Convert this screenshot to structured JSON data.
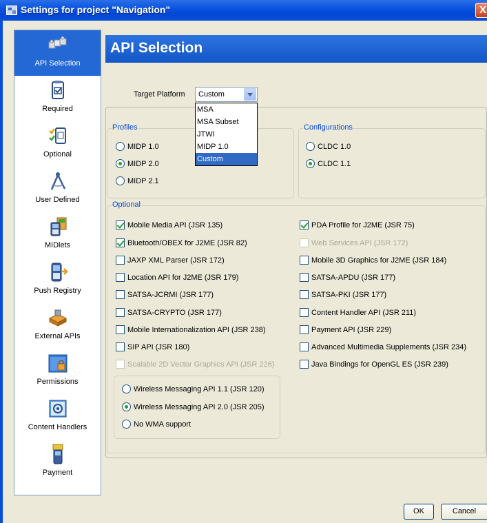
{
  "window": {
    "title": "Settings for project \"Navigation\"",
    "close_label": "X"
  },
  "sidebar": {
    "items": [
      {
        "label": "API Selection",
        "icon": "puzzle-pieces-icon"
      },
      {
        "label": "Required",
        "icon": "clipboard-check-icon"
      },
      {
        "label": "Optional",
        "icon": "checklist-icon"
      },
      {
        "label": "User Defined",
        "icon": "compass-icon"
      },
      {
        "label": "MIDlets",
        "icon": "phone-apps-icon"
      },
      {
        "label": "Push Registry",
        "icon": "phone-push-icon"
      },
      {
        "label": "External APIs",
        "icon": "puzzle-piece-icon"
      },
      {
        "label": "Permissions",
        "icon": "folder-lock-icon"
      },
      {
        "label": "Content Handlers",
        "icon": "media-handler-icon"
      },
      {
        "label": "Payment",
        "icon": "phone-payment-icon"
      }
    ],
    "selected_index": 0
  },
  "header": {
    "title": "API Selection"
  },
  "target_platform": {
    "label": "Target Platform",
    "value": "Custom",
    "options": [
      "MSA",
      "MSA Subset",
      "JTWI",
      "MIDP 1.0",
      "Custom"
    ],
    "selected_option": "Custom"
  },
  "profiles": {
    "legend": "Profiles",
    "options": [
      {
        "label": "MIDP 1.0",
        "checked": false
      },
      {
        "label": "MIDP 2.0",
        "checked": true
      },
      {
        "label": "MIDP 2.1",
        "checked": false
      }
    ]
  },
  "configurations": {
    "legend": "Configurations",
    "options": [
      {
        "label": "CLDC 1.0",
        "checked": false
      },
      {
        "label": "CLDC 1.1",
        "checked": true
      }
    ]
  },
  "optional": {
    "legend": "Optional",
    "left": [
      {
        "label": "Mobile Media API (JSR 135)",
        "checked": true,
        "enabled": true
      },
      {
        "label": "Bluetooth/OBEX for J2ME (JSR 82)",
        "checked": true,
        "enabled": true
      },
      {
        "label": "JAXP XML Parser (JSR 172)",
        "checked": false,
        "enabled": true
      },
      {
        "label": "Location API for J2ME (JSR 179)",
        "checked": false,
        "enabled": true
      },
      {
        "label": "SATSA-JCRMI (JSR 177)",
        "checked": false,
        "enabled": true
      },
      {
        "label": "SATSA-CRYPTO (JSR 177)",
        "checked": false,
        "enabled": true
      },
      {
        "label": "Mobile Internationalization API (JSR 238)",
        "checked": false,
        "enabled": true
      },
      {
        "label": "SIP API (JSR 180)",
        "checked": false,
        "enabled": true
      },
      {
        "label": "Scalable 2D Vector Graphics API (JSR 226)",
        "checked": false,
        "enabled": false
      }
    ],
    "right": [
      {
        "label": "PDA Profile for J2ME (JSR 75)",
        "checked": true,
        "enabled": true
      },
      {
        "label": "Web Services API (JSR 172)",
        "checked": false,
        "enabled": false
      },
      {
        "label": "Mobile 3D Graphics for J2ME (JSR 184)",
        "checked": false,
        "enabled": true
      },
      {
        "label": "SATSA-APDU (JSR 177)",
        "checked": false,
        "enabled": true
      },
      {
        "label": "SATSA-PKI (JSR 177)",
        "checked": false,
        "enabled": true
      },
      {
        "label": "Content Handler API (JSR 211)",
        "checked": false,
        "enabled": true
      },
      {
        "label": "Payment API (JSR 229)",
        "checked": false,
        "enabled": true
      },
      {
        "label": "Advanced Multimedia Supplements (JSR 234)",
        "checked": false,
        "enabled": true
      },
      {
        "label": "Java Bindings for OpenGL ES (JSR 239)",
        "checked": false,
        "enabled": true
      }
    ],
    "wma": [
      {
        "label": "Wireless Messaging API 1.1 (JSR 120)",
        "checked": false
      },
      {
        "label": "Wireless Messaging API 2.0 (JSR 205)",
        "checked": true
      },
      {
        "label": "No WMA support",
        "checked": false
      }
    ]
  },
  "buttons": {
    "ok": "OK",
    "cancel": "Cancel"
  },
  "colors": {
    "accent": "#2468d6",
    "legend": "#0046d5",
    "check": "#21a121",
    "dialog_bg": "#ece9d8"
  }
}
